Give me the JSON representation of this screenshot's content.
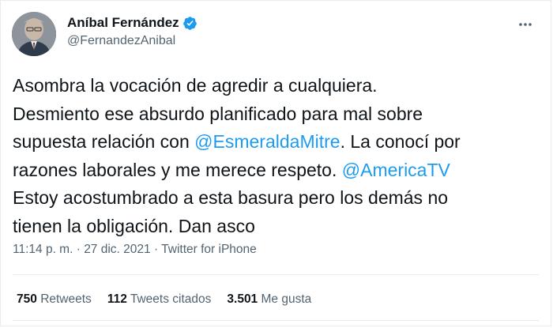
{
  "author": {
    "name": "Aníbal Fernández",
    "handle": "@FernandezAnibal",
    "verified": true
  },
  "more_icon": "more-horizontal-icon",
  "tweet": {
    "line1": "Asombra la vocación de agredir a cualquiera.",
    "line2": "Desmiento ese absurdo planificado para mal sobre",
    "line3_pre": "supuesta relación con ",
    "mention1": "@EsmeraldaMitre",
    "line3_post": ". La conocí por",
    "line4_pre": "razones laborales y me merece respeto. ",
    "mention2": "@AmericaTV",
    "line5": "Estoy acostumbrado a esta basura pero los demás no",
    "line6": "tienen la obligación. Dan asco"
  },
  "meta": {
    "time": "11:14 p. m.",
    "sep1": " · ",
    "date": "27 dic. 2021",
    "sep2": " · ",
    "source": "Twitter for iPhone"
  },
  "stats": {
    "retweets_count": "750",
    "retweets_label": "Retweets",
    "quotes_count": "112",
    "quotes_label": "Tweets citados",
    "likes_count": "3.501",
    "likes_label": "Me gusta"
  },
  "colors": {
    "link": "#1d9bf0",
    "secondary": "#536471",
    "text": "#0f1419",
    "border": "#e6ecf0"
  }
}
